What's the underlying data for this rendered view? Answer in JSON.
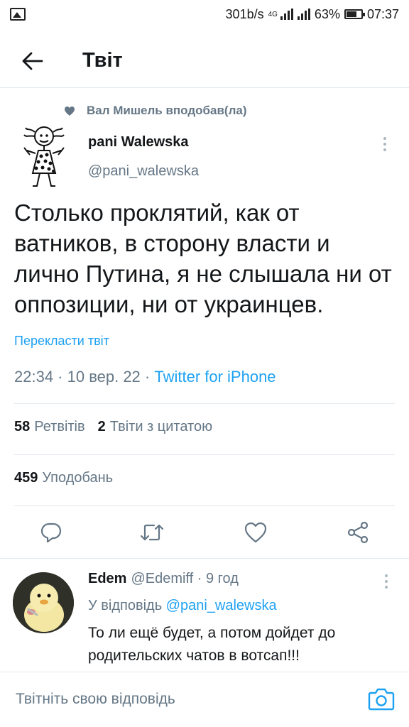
{
  "status_bar": {
    "speed": "301b/s",
    "network": "4G",
    "battery": "63%",
    "time": "07:37"
  },
  "header": {
    "title": "Твіт"
  },
  "tweet": {
    "social_context": "Вал Мишель вподобав(ла)",
    "author_name": "pani Walewska",
    "author_handle": "@pani_walewska",
    "text": "Столько проклятий, как от ватников, в сторону власти и лично Путина, я не слышала ни от оппозиции, ни от украинцев.",
    "translate_label": "Перекласти твіт",
    "time": "22:34 · 10 вер. 22 · ",
    "source": "Twitter for iPhone",
    "retweets_count": "58",
    "retweets_label": "Ретвітів",
    "quotes_count": "2",
    "quotes_label": "Твіти з цитатою",
    "likes_count": "459",
    "likes_label": "Уподобань"
  },
  "reply": {
    "author_name": "Edem",
    "author_handle": "@Edemiff",
    "separator": " · ",
    "time": "9 год",
    "reply_to_prefix": "У відповідь ",
    "reply_to_handle": "@pani_walewska",
    "text": "То ли ещё будет, а потом дойдет до родительских чатов в вотсап!!!"
  },
  "composer": {
    "placeholder": "Твітніть свою відповідь"
  },
  "colors": {
    "accent": "#1da1f2",
    "secondary_text": "#657786",
    "primary_text": "#14171a",
    "divider": "#e1e8ed"
  },
  "icons": [
    "gallery-icon",
    "signal-icon",
    "battery-icon",
    "back-arrow-icon",
    "heart-filled-icon",
    "more-icon",
    "reply-icon",
    "retweet-icon",
    "like-icon",
    "share-icon",
    "camera-icon"
  ]
}
